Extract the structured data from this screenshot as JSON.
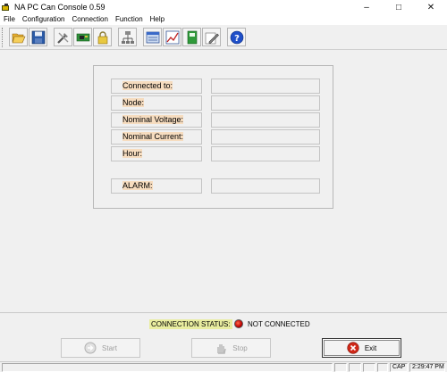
{
  "window": {
    "title": "NA PC Can Console 0.59",
    "minimize": "–",
    "maximize": "□",
    "close": "✕"
  },
  "menu": [
    "File",
    "Configuration",
    "Connection",
    "Function",
    "Help"
  ],
  "toolbar": {
    "buttons": [
      "open-folder",
      "save",
      "tools",
      "board",
      "lock",
      "network",
      "panel",
      "chart",
      "book",
      "edit",
      "help"
    ]
  },
  "info": {
    "connected_to_label": "Connected to:",
    "node_label": "Node:",
    "nominal_voltage_label": "Nominal Voltage:",
    "nominal_current_label": "Nominal Current:",
    "hour_label": "Hour:",
    "alarm_label": "ALARM:",
    "connected_to_value": "",
    "node_value": "",
    "nominal_voltage_value": "",
    "nominal_current_value": "",
    "hour_value": "",
    "alarm_value": ""
  },
  "connection": {
    "status_label": "CONNECTION STATUS:",
    "status_value": "NOT CONNECTED",
    "led_color": "#c00000"
  },
  "buttons": {
    "start": "Start",
    "stop": "Stop",
    "exit": "Exit"
  },
  "statusbar": {
    "caps": "CAP",
    "time": "2:29:47 PM"
  }
}
